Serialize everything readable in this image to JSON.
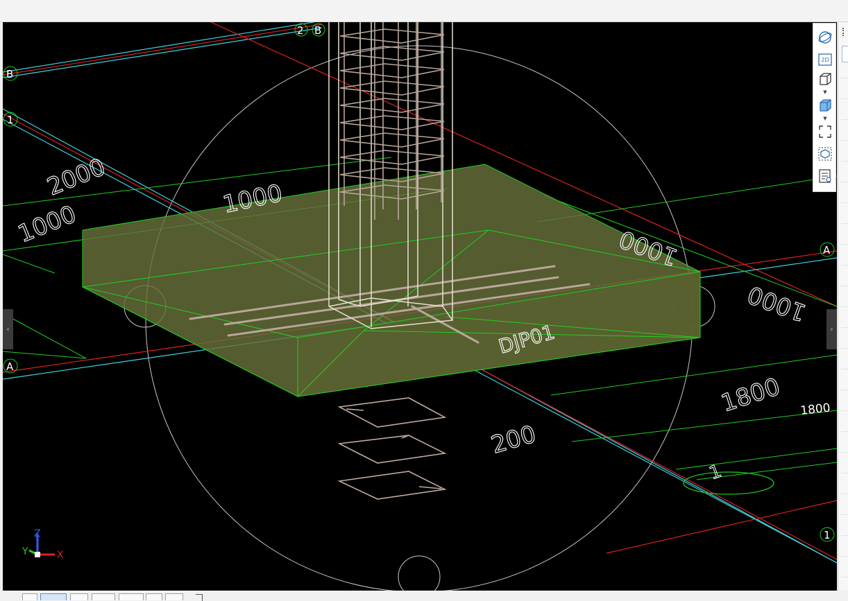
{
  "viewport": {
    "grid_labels": [
      "2",
      "B",
      "B",
      "1",
      "A",
      "A",
      "1"
    ],
    "dimension_labels": [
      "2000",
      "1000",
      "1000",
      "1000",
      "1000",
      "1800",
      "200"
    ],
    "dimension_small": "1800",
    "foundation_label": "DJP01",
    "bubble_marker": "1",
    "axis": {
      "x": "X",
      "y": "Y",
      "z": "Z"
    }
  },
  "side_tabs": {
    "left": "‹",
    "right": "›"
  },
  "view_toolbar": {
    "items": [
      "orbit-icon",
      "2d-view-icon",
      "iso-cube-icon",
      "shaded-cube-icon",
      "zoom-extents-icon",
      "section-box-icon",
      "display-settings-icon"
    ],
    "label_2d": "2D"
  },
  "colors": {
    "grid_cyan": "#3fd3e0",
    "grid_red": "#e02020",
    "dim_green": "#20d020",
    "concrete": "#67703a",
    "rebar": "#c0aaa0"
  }
}
